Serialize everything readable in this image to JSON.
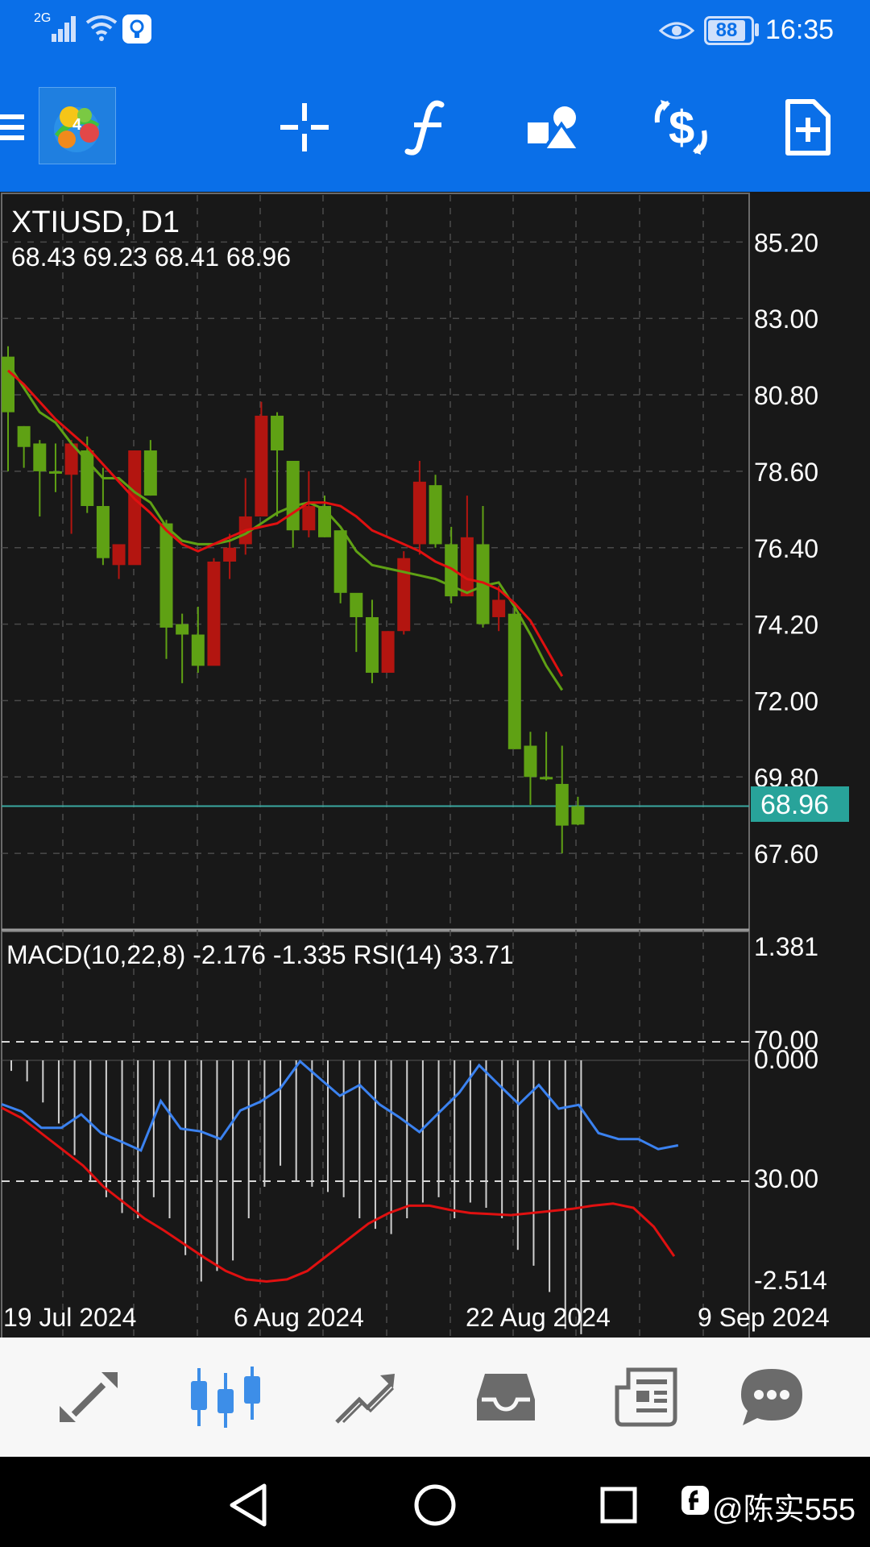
{
  "status_bar": {
    "network": "2G",
    "battery": "88",
    "time": "16:35"
  },
  "toolbar": {
    "icons": [
      "menu-icon",
      "app-logo",
      "crosshair-icon",
      "indicators-icon",
      "objects-icon",
      "trade-icon",
      "new-order-icon"
    ]
  },
  "chart": {
    "symbol_label": "XTIUSD, D1",
    "ohlc_label": "68.43 69.23 68.41 68.96",
    "price_ticks": [
      "85.20",
      "83.00",
      "80.80",
      "78.60",
      "76.40",
      "74.20",
      "72.00",
      "69.80",
      "67.60"
    ],
    "current_price": "68.96",
    "indicator_label": "MACD(10,22,8) -2.176 -1.335 RSI(14) 33.71",
    "indicator_ticks": {
      "top": "1.381",
      "rsi_high": "70.00",
      "zero": "0.000",
      "rsi_low": "30.00",
      "bottom": "-2.514"
    },
    "date_labels": [
      "19 Jul 2024",
      "6 Aug 2024",
      "22 Aug 2024",
      "9 Sep 2024"
    ],
    "colors": {
      "background": "#181818",
      "bull": "#5fa114",
      "bear": "#b31510",
      "ma_fast": "#5fa114",
      "ma_slow": "#e01010",
      "macd_signal": "#e01010",
      "rsi": "#3b82f0",
      "price_line": "#3aa7a0",
      "grid": "#4a4a4a"
    }
  },
  "chart_data": {
    "type": "candlestick",
    "title": "XTIUSD, D1",
    "ylim": [
      65.4,
      86.6
    ],
    "candles": [
      {
        "o": 80.3,
        "h": 82.2,
        "l": 78.6,
        "c": 81.9
      },
      {
        "o": 79.3,
        "h": 79.9,
        "l": 78.7,
        "c": 79.9
      },
      {
        "o": 78.6,
        "h": 79.5,
        "l": 77.3,
        "c": 79.4
      },
      {
        "o": 78.6,
        "h": 79.4,
        "l": 78.0,
        "c": 78.6
      },
      {
        "o": 79.4,
        "h": 79.5,
        "l": 76.8,
        "c": 78.5
      },
      {
        "o": 77.6,
        "h": 79.6,
        "l": 77.4,
        "c": 79.2
      },
      {
        "o": 76.1,
        "h": 78.7,
        "l": 75.9,
        "c": 77.6
      },
      {
        "o": 76.5,
        "h": 76.3,
        "l": 75.5,
        "c": 75.9
      },
      {
        "o": 79.2,
        "h": 79.2,
        "l": 76.0,
        "c": 75.9
      },
      {
        "o": 77.9,
        "h": 79.5,
        "l": 77.9,
        "c": 79.2
      },
      {
        "o": 74.1,
        "h": 77.2,
        "l": 73.2,
        "c": 77.1
      },
      {
        "o": 73.9,
        "h": 74.5,
        "l": 72.5,
        "c": 74.2
      },
      {
        "o": 73.0,
        "h": 74.7,
        "l": 72.8,
        "c": 73.9
      },
      {
        "o": 76.0,
        "h": 76.1,
        "l": 73.3,
        "c": 73.0
      },
      {
        "o": 76.4,
        "h": 76.8,
        "l": 75.5,
        "c": 76.0
      },
      {
        "o": 77.3,
        "h": 78.4,
        "l": 76.2,
        "c": 76.5
      },
      {
        "o": 80.2,
        "h": 80.6,
        "l": 77.5,
        "c": 77.3
      },
      {
        "o": 79.2,
        "h": 80.3,
        "l": 77.3,
        "c": 80.2
      },
      {
        "o": 76.9,
        "h": 78.9,
        "l": 76.4,
        "c": 78.9
      },
      {
        "o": 77.6,
        "h": 78.6,
        "l": 76.7,
        "c": 76.9
      },
      {
        "o": 76.7,
        "h": 77.9,
        "l": 76.7,
        "c": 77.6
      },
      {
        "o": 75.1,
        "h": 76.9,
        "l": 74.8,
        "c": 76.9
      },
      {
        "o": 74.4,
        "h": 75.0,
        "l": 73.4,
        "c": 75.1
      },
      {
        "o": 72.8,
        "h": 74.9,
        "l": 72.5,
        "c": 74.4
      },
      {
        "o": 74.0,
        "h": 74.0,
        "l": 72.8,
        "c": 72.8
      },
      {
        "o": 76.1,
        "h": 76.3,
        "l": 73.9,
        "c": 74.0
      },
      {
        "o": 78.3,
        "h": 78.9,
        "l": 76.2,
        "c": 76.5
      },
      {
        "o": 76.5,
        "h": 78.5,
        "l": 76.4,
        "c": 78.2
      },
      {
        "o": 75.0,
        "h": 77.0,
        "l": 74.8,
        "c": 76.5
      },
      {
        "o": 76.7,
        "h": 77.9,
        "l": 75.0,
        "c": 75.0
      },
      {
        "o": 74.2,
        "h": 77.6,
        "l": 74.1,
        "c": 76.5
      },
      {
        "o": 74.9,
        "h": 75.3,
        "l": 74.0,
        "c": 74.4
      },
      {
        "o": 70.6,
        "h": 74.7,
        "l": 70.6,
        "c": 74.5
      },
      {
        "o": 69.8,
        "h": 71.1,
        "l": 69.0,
        "c": 70.7
      },
      {
        "o": 69.8,
        "h": 71.1,
        "l": 69.7,
        "c": 69.8
      },
      {
        "o": 68.4,
        "h": 70.7,
        "l": 67.6,
        "c": 69.6
      },
      {
        "o": 68.43,
        "h": 69.23,
        "l": 68.41,
        "c": 68.96
      }
    ],
    "ma_fast": [
      81.7,
      81.0,
      80.3,
      80.0,
      79.4,
      78.9,
      78.4,
      78.4,
      78.0,
      77.7,
      77.0,
      76.6,
      76.5,
      76.5,
      76.6,
      76.8,
      77.1,
      77.4,
      77.6,
      77.7,
      77.5,
      77.0,
      76.3,
      75.9,
      75.8,
      75.7,
      75.6,
      75.5,
      75.3,
      75.1,
      75.3,
      75.4,
      74.7,
      73.9,
      73.0,
      72.3
    ],
    "ma_slow": [
      81.5,
      81.1,
      80.6,
      80.1,
      79.7,
      79.3,
      78.8,
      78.3,
      77.8,
      77.4,
      76.9,
      76.5,
      76.3,
      76.5,
      76.7,
      76.9,
      77.0,
      77.1,
      77.4,
      77.7,
      77.7,
      77.6,
      77.3,
      76.9,
      76.7,
      76.5,
      76.3,
      76.0,
      75.8,
      75.5,
      75.4,
      75.2,
      74.8,
      74.3,
      73.5,
      72.7
    ],
    "macd_hist": [
      -0.1,
      -0.2,
      -0.4,
      -0.6,
      -0.9,
      -1.15,
      -1.3,
      -1.45,
      -1.5,
      -1.3,
      -1.5,
      -1.85,
      -2.1,
      -2.0,
      -1.9,
      -1.5,
      -1.2,
      -1.0,
      -1.15,
      -1.2,
      -1.25,
      -1.3,
      -1.5,
      -1.6,
      -1.65,
      -1.5,
      -1.35,
      -1.3,
      -1.5,
      -1.35,
      -1.4,
      -1.5,
      -1.8,
      -1.95,
      -2.2,
      -2.55,
      -2.6
    ],
    "macd_signal": [
      -0.45,
      -0.55,
      -0.7,
      -0.85,
      -1.0,
      -1.2,
      -1.35,
      -1.5,
      -1.62,
      -1.75,
      -1.88,
      -2.0,
      -2.08,
      -2.1,
      -2.08,
      -2.0,
      -1.85,
      -1.7,
      -1.55,
      -1.45,
      -1.38,
      -1.38,
      -1.42,
      -1.45,
      -1.46,
      -1.47,
      -1.45,
      -1.43,
      -1.41,
      -1.38,
      -1.36,
      -1.4,
      -1.58,
      -1.86
    ],
    "rsi": [
      52.1,
      50.0,
      45.3,
      45.3,
      49.2,
      43.8,
      41.4,
      38.8,
      53.0,
      45.1,
      44.3,
      42.1,
      50.3,
      52.8,
      56.6,
      64.4,
      59.4,
      54.5,
      57.6,
      52.0,
      48.3,
      44.1,
      49.8,
      55.4,
      63.3,
      57.6,
      52.1,
      57.6,
      50.8,
      51.9,
      43.8,
      42.1,
      42.1,
      39.2,
      40.3
    ],
    "macd_range": [
      -2.514,
      1.381
    ],
    "rsi_levels": [
      30,
      70
    ]
  },
  "bottom_nav": {
    "items": [
      "quotes-icon",
      "chart-icon",
      "trade-nav-icon",
      "history-icon",
      "news-icon",
      "messages-icon"
    ],
    "active": "chart-icon"
  },
  "system_nav": {
    "watermark": "@陈实555"
  }
}
